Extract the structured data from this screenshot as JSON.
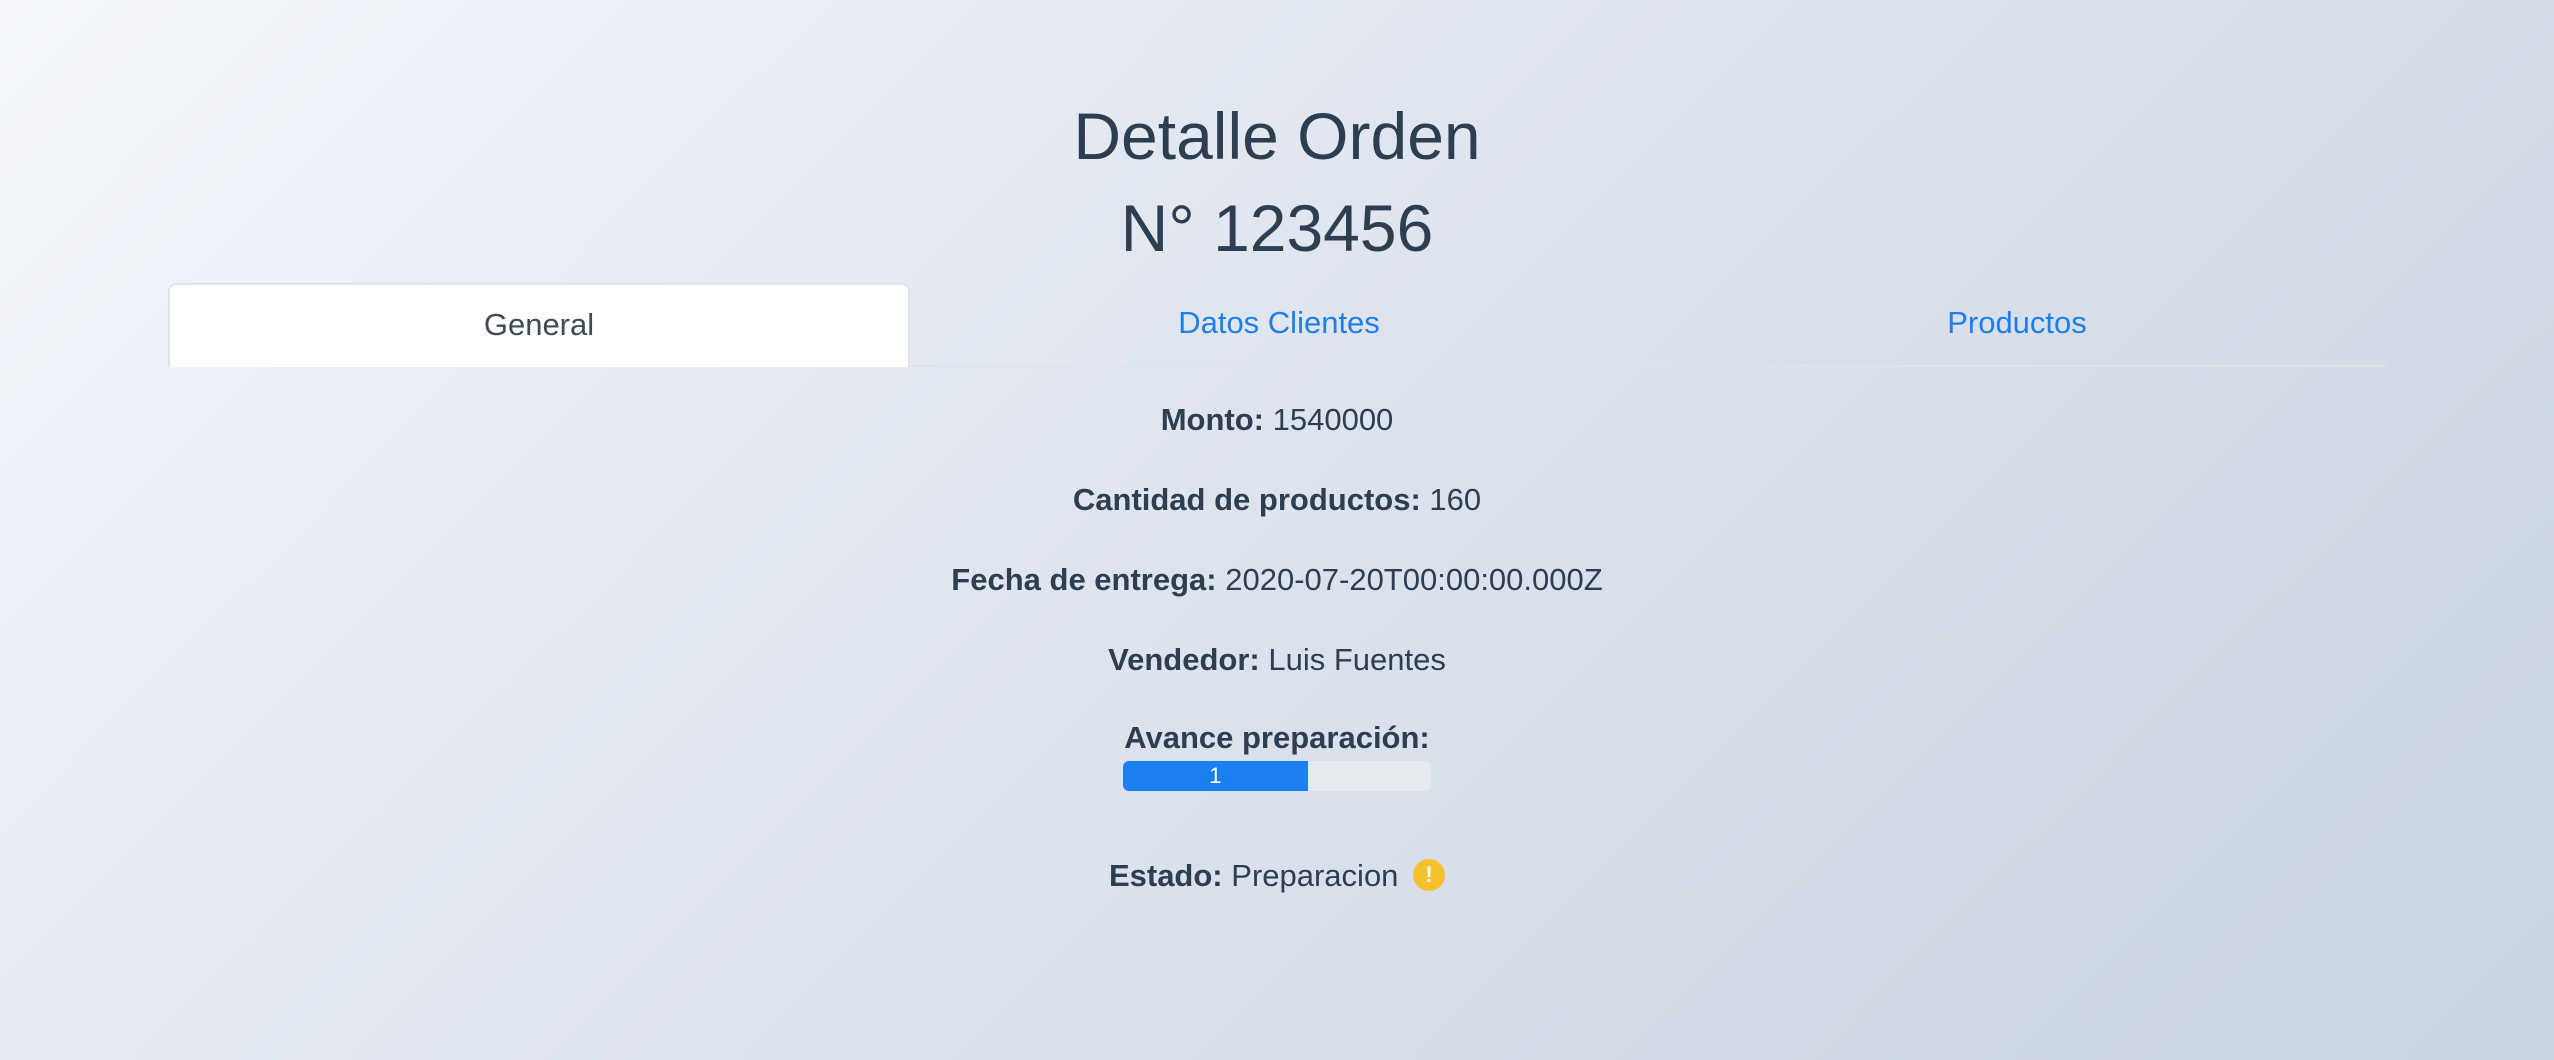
{
  "header": {
    "title_line1": "Detalle Orden",
    "title_line2": "N° 123456"
  },
  "tabs": [
    {
      "label": "General",
      "active": true
    },
    {
      "label": "Datos Clientes",
      "active": false
    },
    {
      "label": "Productos",
      "active": false
    }
  ],
  "details": {
    "monto": {
      "label": "Monto:",
      "value": "1540000"
    },
    "cantidad": {
      "label": "Cantidad de productos:",
      "value": "160"
    },
    "fecha": {
      "label": "Fecha de entrega:",
      "value": "2020-07-20T00:00:00.000Z"
    },
    "vendedor": {
      "label": "Vendedor:",
      "value": "Luis Fuentes"
    },
    "avance": {
      "label": "Avance preparación:",
      "value_text": "1",
      "percent": 60
    },
    "estado": {
      "label": "Estado:",
      "value": "Preparacion",
      "icon": "warning-icon",
      "icon_glyph": "!",
      "icon_color": "#f6c12d"
    }
  },
  "colors": {
    "accent": "#1f7fe8",
    "progress": "#1a7ff0",
    "text": "#2c3e50"
  }
}
